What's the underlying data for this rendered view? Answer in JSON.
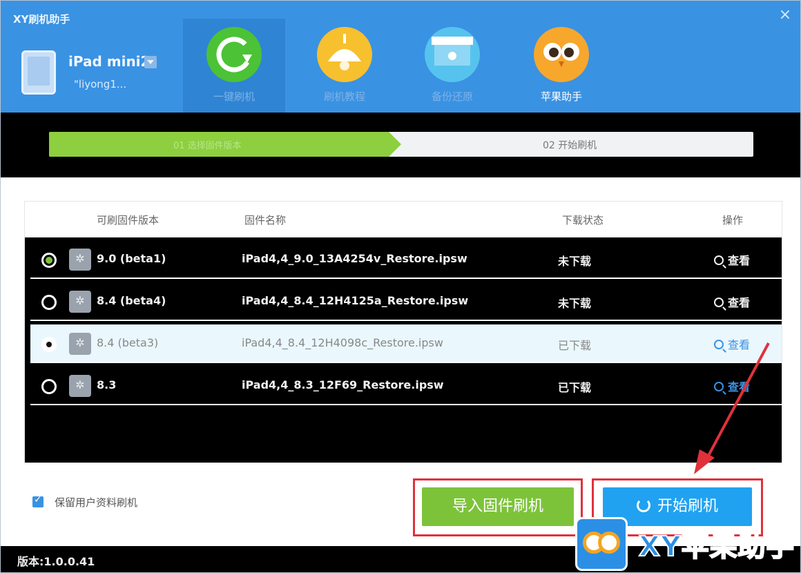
{
  "app": {
    "title": "XY刷机助手",
    "close_glyph": "×"
  },
  "device": {
    "name": "iPad mini2",
    "user": "\"liyong1..."
  },
  "nav": [
    {
      "label": "一键刷机",
      "color": "#4cc236",
      "icon": "refresh-circle-icon"
    },
    {
      "label": "刷机教程",
      "color": "#f7c02e",
      "icon": "lamp-icon"
    },
    {
      "label": "备份还原",
      "color": "#56c3ee",
      "icon": "backup-box-icon"
    },
    {
      "label": "苹果助手",
      "color": "#f7a72c",
      "icon": "owl-icon"
    }
  ],
  "progress": {
    "fraction": 0.5,
    "step1": "01 选择固件版本",
    "step2": "02  开始刷机",
    "fill_color": "#8dcf3f"
  },
  "table": {
    "headers": {
      "version": "可刷固件版本",
      "name": "固件名称",
      "status": "下载状态",
      "action": "操作"
    },
    "rows": [
      {
        "version": "9.0 (beta1)",
        "name": "iPad4,4_9.0_13A4254v_Restore.ipsw",
        "status": "未下载",
        "action": "查看"
      },
      {
        "version": "8.4 (beta4)",
        "name": "iPad4,4_8.4_12H4125a_Restore.ipsw",
        "status": "未下载",
        "action": "查看"
      },
      {
        "version": "8.4 (beta3)",
        "name": "iPad4,4_8.4_12H4098c_Restore.ipsw",
        "status": "已下载",
        "action": "查看"
      },
      {
        "version": "8.3",
        "name": "iPad4,4_8.3_12F69_Restore.ipsw",
        "status": "已下载",
        "action": "查看"
      }
    ]
  },
  "keep_data": {
    "label": "保留用户资料刷机",
    "checked": true
  },
  "buttons": {
    "import": "导入固件刷机",
    "start": "开始刷机"
  },
  "status": {
    "version": "版本:1.0.0.41"
  },
  "watermark": {
    "text": "XY苹果助手"
  },
  "colors": {
    "header_blue": "#3a92e3",
    "start_blue": "#20a2f0",
    "import_green": "#7dc33a",
    "highlight_red": "#e0313b"
  }
}
